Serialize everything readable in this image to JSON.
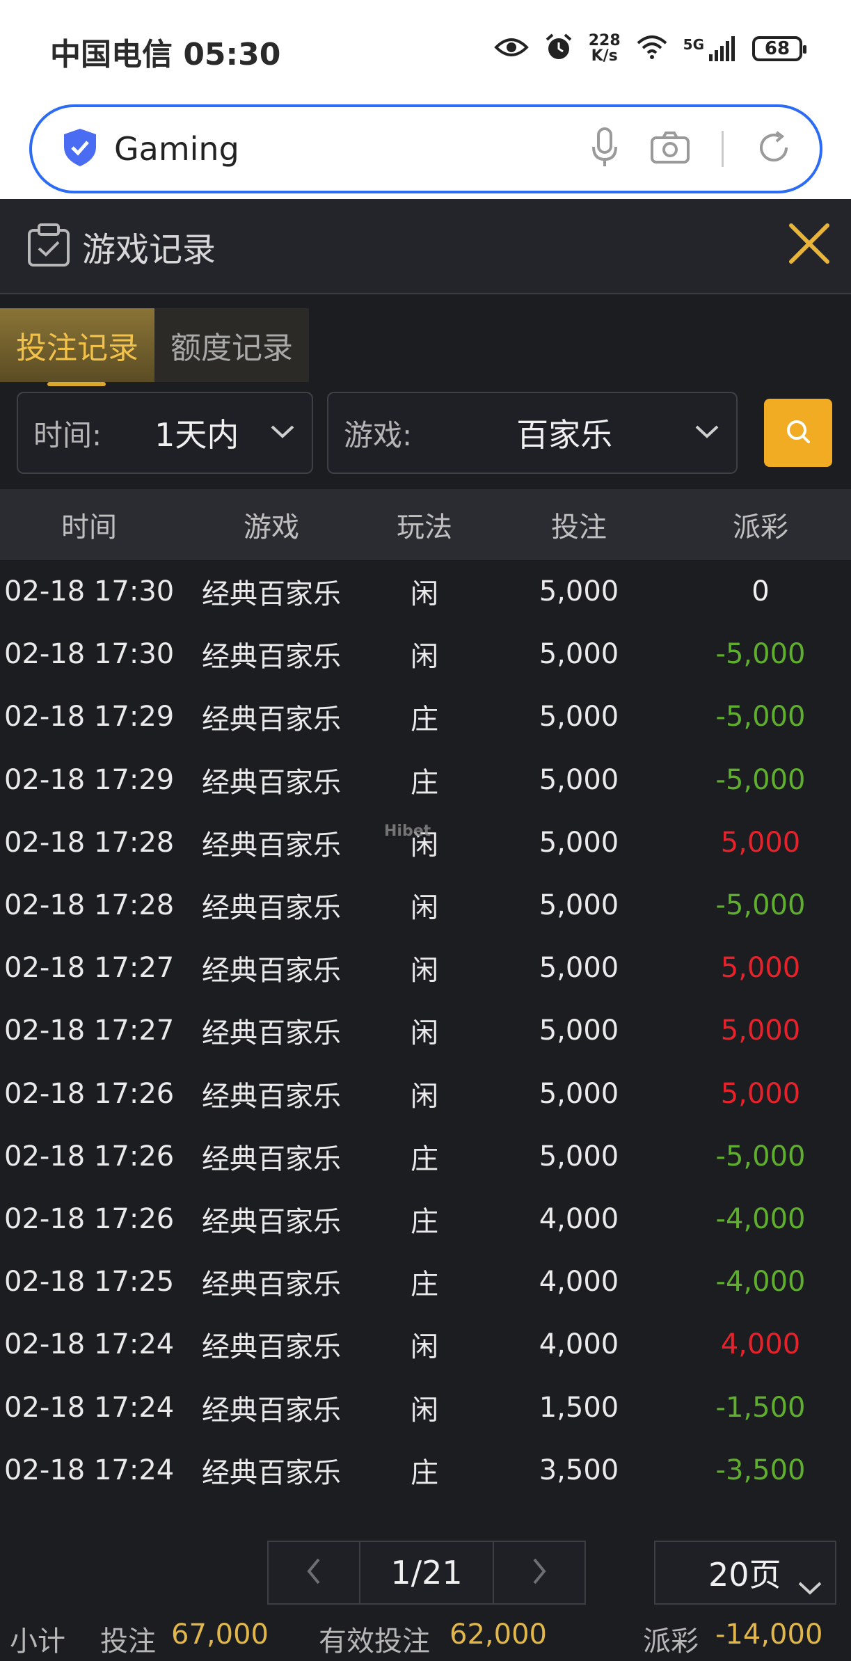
{
  "status_bar": {
    "carrier_time": "中国电信 05:30",
    "net_speed_value": "228",
    "net_speed_unit": "K/s",
    "network": "5G",
    "battery": "68"
  },
  "address_bar": {
    "text": "Gaming"
  },
  "panel": {
    "title": "游戏记录"
  },
  "tabs": [
    {
      "label": "投注记录",
      "active": true
    },
    {
      "label": "额度记录",
      "active": false
    }
  ],
  "filters": {
    "time_label": "时间:",
    "time_value": "1天内",
    "game_label": "游戏:",
    "game_value": "百家乐"
  },
  "table": {
    "headers": [
      "时间",
      "游戏",
      "玩法",
      "投注",
      "派彩"
    ],
    "rows": [
      {
        "time": "02-18 17:30",
        "game": "经典百家乐",
        "play": "闲",
        "bet": "5,000",
        "payout": "0"
      },
      {
        "time": "02-18 17:30",
        "game": "经典百家乐",
        "play": "闲",
        "bet": "5,000",
        "payout": "-5,000"
      },
      {
        "time": "02-18 17:29",
        "game": "经典百家乐",
        "play": "庄",
        "bet": "5,000",
        "payout": "-5,000"
      },
      {
        "time": "02-18 17:29",
        "game": "经典百家乐",
        "play": "庄",
        "bet": "5,000",
        "payout": "-5,000"
      },
      {
        "time": "02-18 17:28",
        "game": "经典百家乐",
        "play": "闲",
        "bet": "5,000",
        "payout": "5,000"
      },
      {
        "time": "02-18 17:28",
        "game": "经典百家乐",
        "play": "闲",
        "bet": "5,000",
        "payout": "-5,000"
      },
      {
        "time": "02-18 17:27",
        "game": "经典百家乐",
        "play": "闲",
        "bet": "5,000",
        "payout": "5,000"
      },
      {
        "time": "02-18 17:27",
        "game": "经典百家乐",
        "play": "闲",
        "bet": "5,000",
        "payout": "5,000"
      },
      {
        "time": "02-18 17:26",
        "game": "经典百家乐",
        "play": "闲",
        "bet": "5,000",
        "payout": "5,000"
      },
      {
        "time": "02-18 17:26",
        "game": "经典百家乐",
        "play": "庄",
        "bet": "5,000",
        "payout": "-5,000"
      },
      {
        "time": "02-18 17:26",
        "game": "经典百家乐",
        "play": "庄",
        "bet": "4,000",
        "payout": "-4,000"
      },
      {
        "time": "02-18 17:25",
        "game": "经典百家乐",
        "play": "庄",
        "bet": "4,000",
        "payout": "-4,000"
      },
      {
        "time": "02-18 17:24",
        "game": "经典百家乐",
        "play": "闲",
        "bet": "4,000",
        "payout": "4,000"
      },
      {
        "time": "02-18 17:24",
        "game": "经典百家乐",
        "play": "闲",
        "bet": "1,500",
        "payout": "-1,500"
      },
      {
        "time": "02-18 17:24",
        "game": "经典百家乐",
        "play": "庄",
        "bet": "3,500",
        "payout": "-3,500"
      }
    ]
  },
  "watermark": "Hibet",
  "pager": {
    "current": "1/21",
    "page_size": "20页"
  },
  "summary": {
    "label": "小计",
    "bet_label": "投注",
    "bet_value": "67,000",
    "valid_bet_label": "有效投注",
    "valid_bet_value": "62,000",
    "payout_label": "派彩",
    "payout_value": "-14,000"
  },
  "colors": {
    "accent": "#f1ac24",
    "payout_negative": "#5fae2e",
    "payout_positive": "#e8222a",
    "address_border": "#2c6cf5"
  }
}
